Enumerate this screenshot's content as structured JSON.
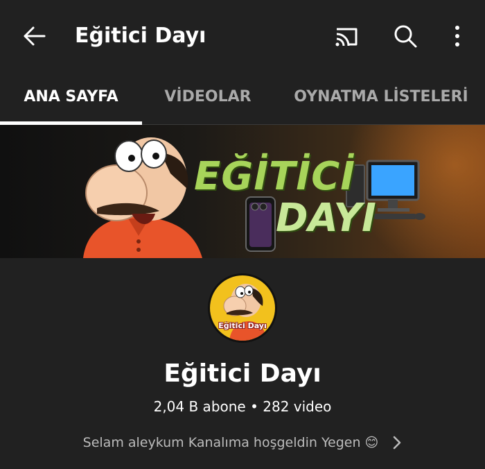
{
  "header": {
    "title": "Eğitici Dayı",
    "icons": {
      "back": "arrow-left-icon",
      "cast": "cast-icon",
      "search": "search-icon",
      "more": "more-vertical-icon"
    }
  },
  "tabs": [
    {
      "label": "ANA SAYFA",
      "selected": true
    },
    {
      "label": "VİDEOLAR",
      "selected": false
    },
    {
      "label": "OYNATMA LİSTELERİ",
      "selected": false
    }
  ],
  "banner": {
    "line1": "EĞİTİCİ",
    "line2": "DAYI"
  },
  "avatar": {
    "label": "Eğitici Dayı"
  },
  "channel": {
    "name": "Eğitici Dayı",
    "stats": "2,04 B abone • 282 video",
    "description": "Selam aleykum Kanalıma hoşgeldin Yegen 😊"
  },
  "colors": {
    "background": "#212121",
    "text_primary": "#ffffff",
    "text_secondary": "#aaaaaa",
    "banner_text": "#a7d45a",
    "avatar_bg": "#f2c11d"
  }
}
